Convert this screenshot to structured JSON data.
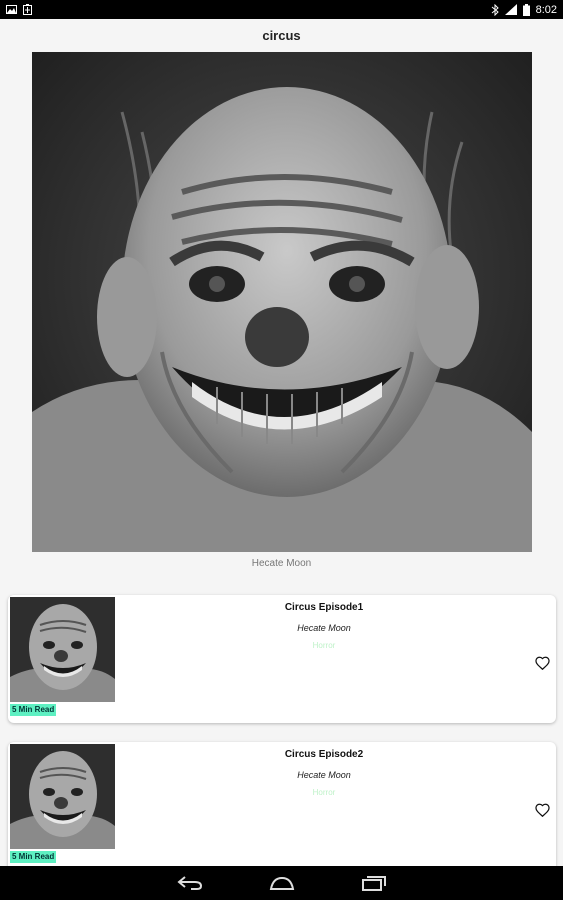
{
  "status_bar": {
    "time": "8:02",
    "left_icons": [
      "image-icon",
      "battery-saver-icon"
    ],
    "right_icons": [
      "bluetooth-icon",
      "signal-icon",
      "battery-icon"
    ]
  },
  "header": {
    "title": "circus"
  },
  "cover": {
    "image": "clown-mask-photo",
    "author": "Hecate Moon"
  },
  "episodes": [
    {
      "title": "Circus Episode1",
      "author": "Hecate Moon",
      "genre": "Horror",
      "read_time": "5 Min Read",
      "icon": "heart-outline-icon"
    },
    {
      "title": "Circus Episode2",
      "author": "Hecate Moon",
      "genre": "Horror",
      "read_time": "5 Min Read",
      "icon": "heart-outline-icon"
    }
  ],
  "nav_bar": {
    "icons": [
      "back-icon",
      "home-icon",
      "recents-icon"
    ]
  },
  "colors": {
    "badge": "#5ef0c2",
    "genre": "#bff2c9",
    "status_bar": "#000000",
    "background": "#f5f5f5"
  }
}
